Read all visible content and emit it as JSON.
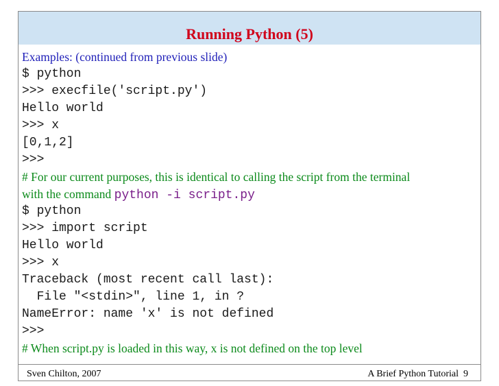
{
  "slide": {
    "title": "Running Python (5)",
    "lines": [
      {
        "text": "Examples: (continued from previous slide)",
        "style": "serif blue"
      },
      {
        "text": "$ python",
        "style": "mono"
      },
      {
        "text": ">>> execfile('script.py')",
        "style": "mono"
      },
      {
        "text": "Hello world",
        "style": "mono"
      },
      {
        "text": ">>> x",
        "style": "mono"
      },
      {
        "text": "[0,1,2]",
        "style": "mono"
      },
      {
        "text": ">>>",
        "style": "mono"
      },
      {
        "text": "# For our current purposes, this is identical to calling the script from the terminal",
        "style": "serif green"
      },
      {
        "text": "with the command ",
        "style": "serif green",
        "code": "python -i script.py"
      },
      {
        "text": "$ python",
        "style": "mono"
      },
      {
        "text": ">>> import script",
        "style": "mono"
      },
      {
        "text": "Hello world",
        "style": "mono"
      },
      {
        "text": ">>> x",
        "style": "mono"
      },
      {
        "text": "Traceback (most recent call last):",
        "style": "mono"
      },
      {
        "text": "  File \"<stdin>\", line 1, in ?",
        "style": "mono"
      },
      {
        "text": "NameError: name 'x' is not defined",
        "style": "mono"
      },
      {
        "text": ">>>",
        "style": "mono"
      },
      {
        "text": "# When script.py is loaded in this way, x is not defined on the top level",
        "style": "serif green"
      }
    ]
  },
  "footer": {
    "author": "Sven Chilton, 2007",
    "course": "A Brief Python Tutorial",
    "page": "9"
  }
}
